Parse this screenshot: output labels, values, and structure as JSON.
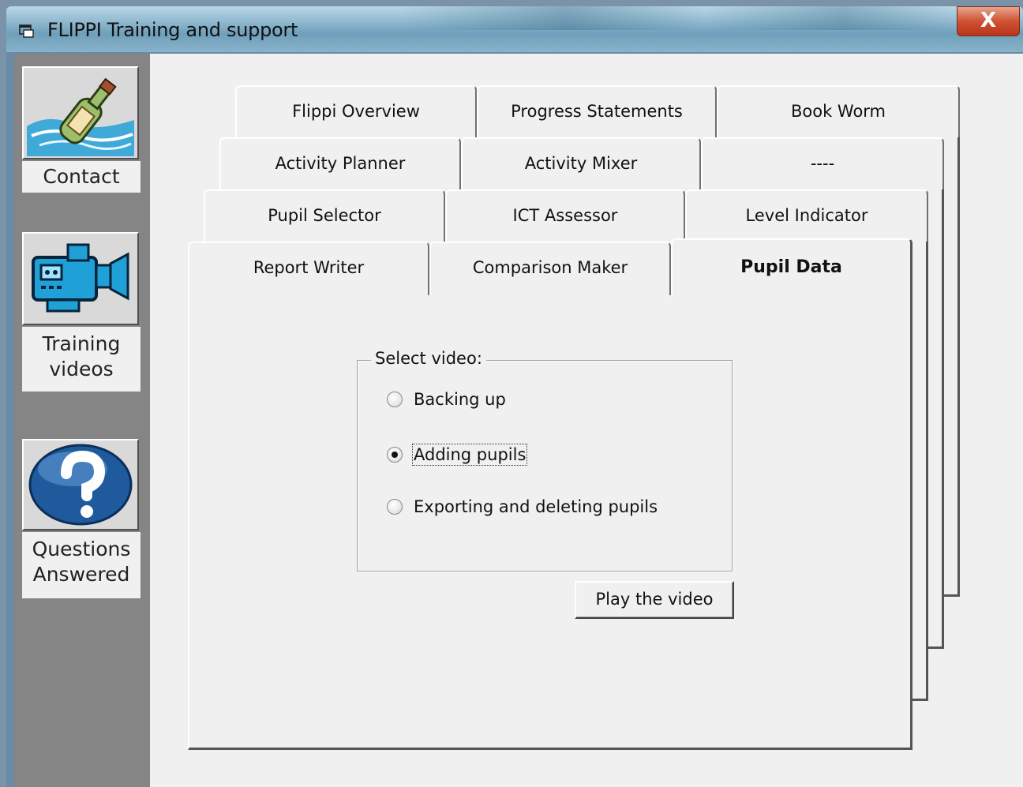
{
  "window": {
    "title": "FLIPPI Training and support",
    "close_label": "X"
  },
  "sidebar": {
    "items": [
      {
        "label": "Contact",
        "icon": "message-bottle-icon"
      },
      {
        "label_line1": "Training",
        "label_line2": "videos",
        "icon": "video-camera-icon"
      },
      {
        "label_line1": "Questions",
        "label_line2": "Answered",
        "icon": "question-mark-icon"
      }
    ]
  },
  "tabs": {
    "row1": [
      "Flippi Overview",
      "Progress Statements",
      "Book Worm"
    ],
    "row2": [
      "Activity Planner",
      "Activity Mixer",
      "----"
    ],
    "row3": [
      "Pupil Selector",
      "ICT Assessor",
      "Level Indicator"
    ],
    "row4": [
      "Report Writer",
      "Comparison Maker",
      "Pupil Data"
    ],
    "active": "Pupil Data"
  },
  "video_group": {
    "legend": "Select video:",
    "options": [
      {
        "label": "Backing up",
        "checked": false
      },
      {
        "label": "Adding pupils",
        "checked": true
      },
      {
        "label": "Exporting and deleting pupils",
        "checked": false
      }
    ]
  },
  "play_button": "Play the video",
  "colors": {
    "title_bar": "#8fb8cf",
    "sidebar": "#858585",
    "close_button": "#cf5233",
    "dialog": "#f0f0f0"
  }
}
